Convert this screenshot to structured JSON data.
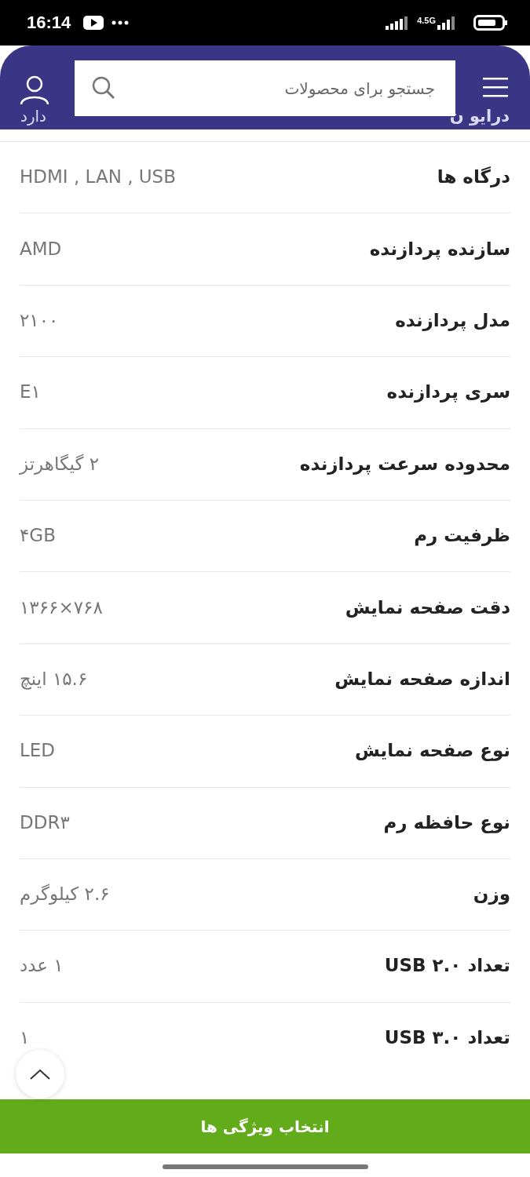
{
  "status_bar": {
    "time": "16:14",
    "network": "4.5G"
  },
  "search": {
    "placeholder": "جستجو برای محصولات"
  },
  "hidden_row": {
    "label": "درایو ن",
    "value": "دارد"
  },
  "specs": [
    {
      "label": "درگاه ها",
      "value": "HDMI , LAN , USB"
    },
    {
      "label": "سازنده پردازنده",
      "value": "AMD"
    },
    {
      "label": "مدل پردازنده",
      "value": "۲۱۰۰"
    },
    {
      "label": "سری پردازنده",
      "value": "E۱"
    },
    {
      "label": "محدوده سرعت پردازنده",
      "value": "۲ گیگاهرتز"
    },
    {
      "label": "ظرفیت رم",
      "value": "۴GB"
    },
    {
      "label": "دقت صفحه نمایش",
      "value": "۷۶۸×۱۳۶۶"
    },
    {
      "label": "اندازه صفحه نمایش",
      "value": "۱۵.۶ اینچ"
    },
    {
      "label": "نوع صفحه نمایش",
      "value": "LED"
    },
    {
      "label": "نوع حافظه رم",
      "value": "DDR۳"
    },
    {
      "label": "وزن",
      "value": "۲.۶ کیلوگرم"
    },
    {
      "label": "تعداد USB ۲.۰",
      "value": "۱ عدد"
    },
    {
      "label": "تعداد USB ۳.۰",
      "value": "۱"
    }
  ],
  "bottom_button": {
    "label": "انتخاب ویژگی ها"
  }
}
